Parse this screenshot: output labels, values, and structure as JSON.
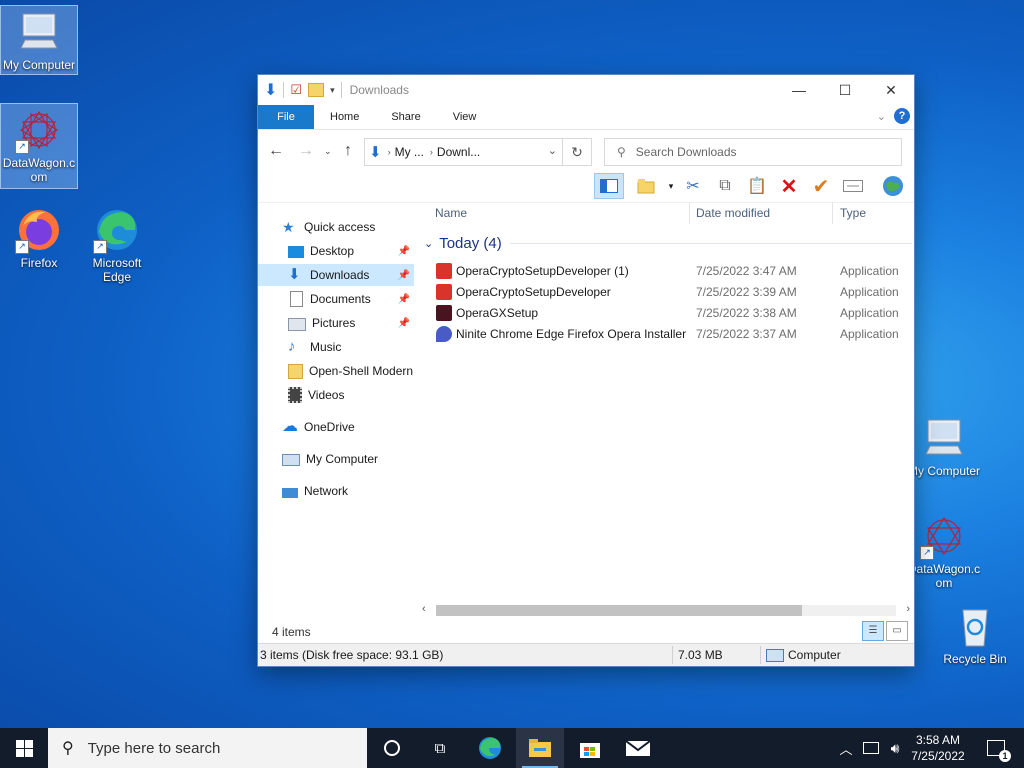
{
  "desktop": {
    "icons": [
      {
        "label": "My Computer"
      },
      {
        "label": "DataWagon.c om"
      },
      {
        "label": "Firefox"
      },
      {
        "label": "Microsoft Edge"
      },
      {
        "label": "My Computer"
      },
      {
        "label": "DataWagon.c om"
      },
      {
        "label": "Recycle Bin"
      }
    ]
  },
  "window": {
    "title": "Downloads",
    "controls": {
      "minimize": "—",
      "maximize": "☐",
      "close": "✕"
    },
    "ribbon_tabs": [
      "File",
      "Home",
      "Share",
      "View"
    ],
    "address": {
      "crumb1": "My ...",
      "crumb2": "Downl..."
    },
    "search_placeholder": "Search Downloads",
    "nav_pane": [
      {
        "label": "Quick access"
      },
      {
        "label": "Desktop"
      },
      {
        "label": "Downloads"
      },
      {
        "label": "Documents"
      },
      {
        "label": "Pictures"
      },
      {
        "label": "Music"
      },
      {
        "label": "Open-Shell Modern"
      },
      {
        "label": "Videos"
      },
      {
        "label": "OneDrive"
      },
      {
        "label": "My Computer"
      },
      {
        "label": "Network"
      }
    ],
    "columns": {
      "name": "Name",
      "date": "Date modified",
      "type": "Type"
    },
    "group_label": "Today (4)",
    "files": [
      {
        "name": "OperaCryptoSetupDeveloper (1)",
        "date": "7/25/2022 3:47 AM",
        "type": "Application"
      },
      {
        "name": "OperaCryptoSetupDeveloper",
        "date": "7/25/2022 3:39 AM",
        "type": "Application"
      },
      {
        "name": "OperaGXSetup",
        "date": "7/25/2022 3:38 AM",
        "type": "Application"
      },
      {
        "name": "Ninite Chrome Edge Firefox Opera Installer",
        "date": "7/25/2022 3:37 AM",
        "type": "Application"
      }
    ],
    "item_count": "4 items",
    "status": {
      "selection": "3 items (Disk free space: 93.1 GB)",
      "size": "7.03 MB",
      "location": "Computer"
    }
  },
  "taskbar": {
    "search_placeholder": "Type here to search",
    "time": "3:58 AM",
    "date": "7/25/2022",
    "notification_count": "1"
  },
  "colors": {
    "accent": "#1979ca",
    "selection": "#cce8ff",
    "taskbar": "#131c2b"
  }
}
